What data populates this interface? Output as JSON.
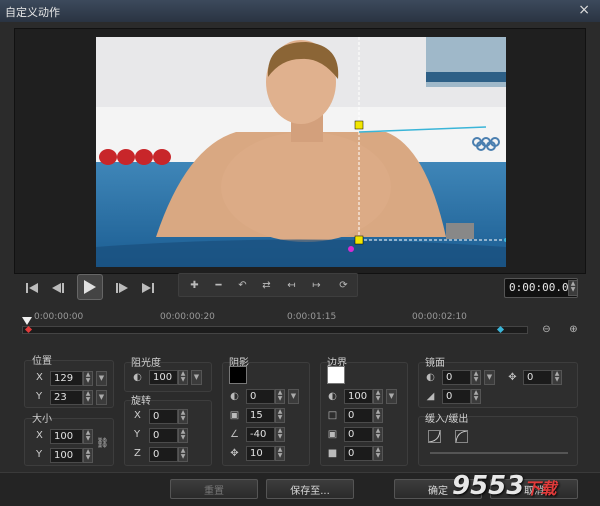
{
  "window": {
    "title": "自定义动作",
    "close_glyph": "×"
  },
  "timeline": {
    "current_time": "0:00:00.00",
    "ruler_labels": [
      "0:00:00:00",
      "00:00:00:20",
      "0:00:01:15",
      "00:00:02:10"
    ]
  },
  "position": {
    "label": "位置",
    "x_label": "X",
    "x_value": "129",
    "y_label": "Y",
    "y_value": "23"
  },
  "size": {
    "label": "大小",
    "x_label": "X",
    "x_value": "100",
    "y_label": "Y",
    "y_value": "100"
  },
  "opacity": {
    "label": "阻光度",
    "value": "100"
  },
  "rotation": {
    "label": "旋转",
    "x_label": "X",
    "x_value": "0",
    "y_label": "Y",
    "y_value": "0",
    "z_label": "Z",
    "z_value": "0"
  },
  "shadow": {
    "label": "阴影",
    "color": "#000000",
    "opacity_value": "0",
    "size_value": "15",
    "angle_value": "-40",
    "distance_value": "10"
  },
  "border": {
    "label": "边界",
    "color": "#ffffff",
    "opacity_value": "100",
    "v1": "0",
    "v2": "0",
    "v3": "0"
  },
  "mirror": {
    "label": "镜面",
    "opacity_value": "0",
    "offset_value": "0",
    "fade_value": "0"
  },
  "ease": {
    "label": "缓入/缓出"
  },
  "buttons": {
    "reset": "重置",
    "save_to": "保存至...",
    "ok": "确定",
    "cancel": "取消"
  },
  "watermark": {
    "brand": "9553",
    "suffix": "下载"
  },
  "colors": {
    "accent": "#3ab5d8",
    "handle": "#f2e600",
    "keyframe": "#e23b3b"
  }
}
